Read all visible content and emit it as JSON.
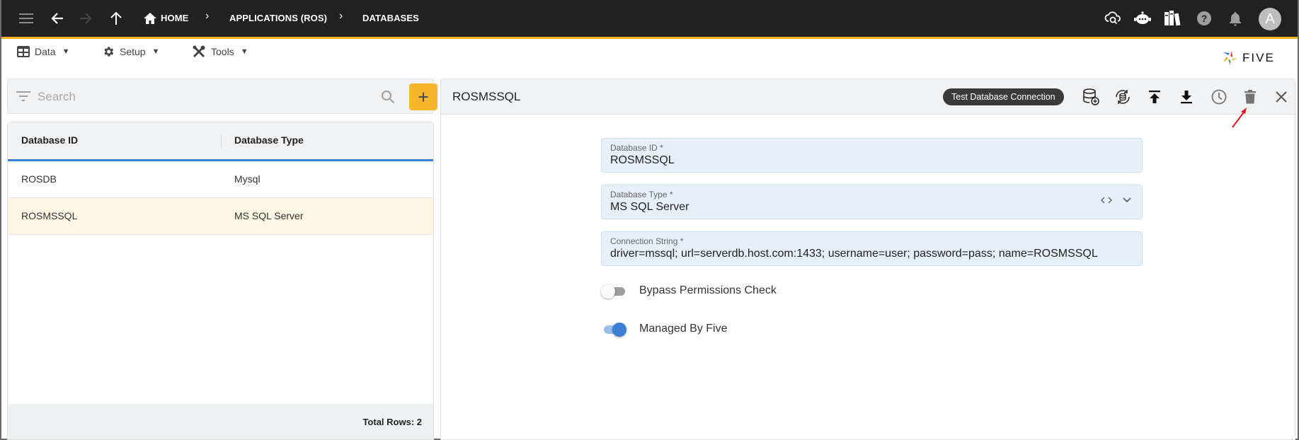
{
  "topbar": {
    "breadcrumbs": [
      {
        "label": "HOME",
        "icon": "home-icon"
      },
      {
        "label": "APPLICATIONS (ROS)"
      },
      {
        "label": "DATABASES"
      }
    ],
    "nav_icons": [
      "menu-icon",
      "back-arrow-icon",
      "forward-arrow-icon",
      "up-arrow-icon"
    ],
    "right_icons": [
      "cloud-search-icon",
      "chatbot-icon",
      "library-books-icon",
      "help-icon",
      "notifications-bell-icon"
    ],
    "avatar_initial": "A",
    "accent_color": "#f0b429"
  },
  "menu": {
    "items": [
      {
        "label": "Data",
        "icon": "table-icon"
      },
      {
        "label": "Setup",
        "icon": "gear-icon"
      },
      {
        "label": "Tools",
        "icon": "tools-icon"
      }
    ],
    "caret": "▼",
    "logo_text": "FIVE"
  },
  "list": {
    "search_placeholder": "Search",
    "add_label": "+",
    "columns": [
      "Database ID",
      "Database Type"
    ],
    "rows": [
      {
        "id": "ROSDB",
        "type": "Mysql",
        "selected": false
      },
      {
        "id": "ROSMSSQL",
        "type": "MS SQL Server",
        "selected": true
      }
    ],
    "total_rows_label": "Total Rows: 2"
  },
  "detail": {
    "title": "ROSMSSQL",
    "test_button_label": "Test Database Connection",
    "toolbar_icons": [
      "database-add-icon",
      "database-sync-icon",
      "upload-icon",
      "download-icon",
      "history-icon",
      "delete-icon",
      "close-icon"
    ],
    "fields": [
      {
        "label": "Database ID *",
        "value": "ROSMSSQL"
      },
      {
        "label": "Database Type *",
        "value": "MS SQL Server"
      },
      {
        "label": "Connection String *",
        "value": "driver=mssql; url=serverdb.host.com:1433; username=user; password=pass; name=ROSMSSQL"
      }
    ],
    "toggles": [
      {
        "label": "Bypass Permissions Check",
        "on": false
      },
      {
        "label": "Managed By Five",
        "on": true
      }
    ],
    "annotation": "red arrow pointing to delete icon"
  }
}
